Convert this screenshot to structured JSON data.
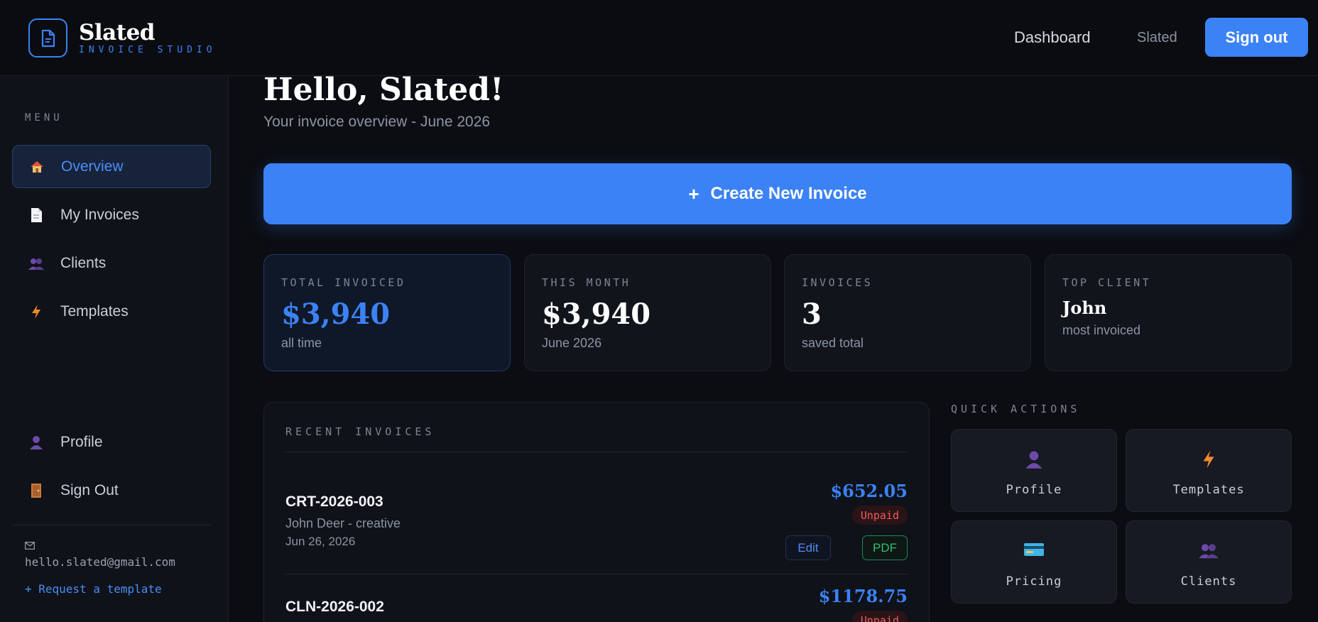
{
  "brand": {
    "name": "Slated",
    "subtitle": "INVOICE STUDIO"
  },
  "header": {
    "nav_dashboard": "Dashboard",
    "nav_user": "Slated",
    "signout_label": "Sign out"
  },
  "sidebar": {
    "menu_label": "MENU",
    "items": [
      {
        "label": "Overview",
        "icon": "home-icon",
        "active": true
      },
      {
        "label": "My Invoices",
        "icon": "document-icon"
      },
      {
        "label": "Clients",
        "icon": "users-icon"
      },
      {
        "label": "Templates",
        "icon": "bolt-icon"
      }
    ],
    "bottom_items": [
      {
        "label": "Profile",
        "icon": "user-icon"
      },
      {
        "label": "Sign Out",
        "icon": "door-icon"
      }
    ],
    "email": "hello.slated@gmail.com",
    "request_template": "+ Request a template"
  },
  "main": {
    "greeting": "Hello, Slated!",
    "subtitle": "Your invoice overview - June 2026",
    "create_label": "Create New Invoice",
    "create_plus": "+",
    "stats": [
      {
        "label": "TOTAL INVOICED",
        "value": "$3,940",
        "sub": "all time"
      },
      {
        "label": "THIS MONTH",
        "value": "$3,940",
        "sub": "June 2026"
      },
      {
        "label": "INVOICES",
        "value": "3",
        "sub": "saved total"
      },
      {
        "label": "TOP CLIENT",
        "value": "John",
        "sub": "most invoiced"
      }
    ],
    "recent": {
      "title": "RECENT INVOICES",
      "invoices": [
        {
          "id": "CRT-2026-003",
          "client": "John Deer - creative",
          "date": "Jun 26, 2026",
          "amount": "$652.05",
          "status": "Unpaid",
          "edit": "Edit",
          "pdf": "PDF"
        },
        {
          "id": "CLN-2026-002",
          "amount": "$1178.75",
          "status": "Unpaid"
        }
      ]
    },
    "quick_actions": {
      "title": "QUICK ACTIONS",
      "items": [
        {
          "label": "Profile",
          "icon": "user-icon"
        },
        {
          "label": "Templates",
          "icon": "bolt-icon"
        },
        {
          "label": "Pricing",
          "icon": "credit-card-icon"
        },
        {
          "label": "Clients",
          "icon": "users-icon"
        }
      ]
    }
  },
  "colors": {
    "accent": "#3b82f6",
    "unpaid": "#f05b5b",
    "pdf": "#2fbf71",
    "background": "#0b0d12"
  }
}
